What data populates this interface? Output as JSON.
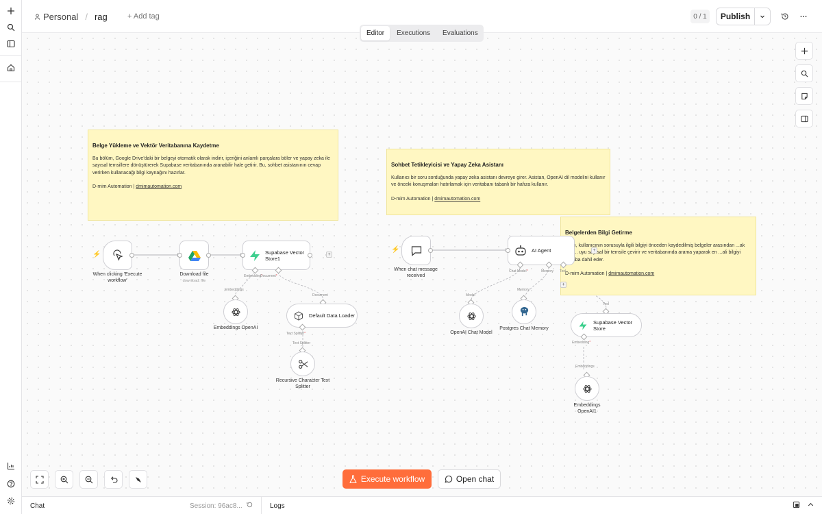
{
  "header": {
    "personal": "Personal",
    "separator": "/",
    "project": "rag",
    "add_tag": "+ Add tag",
    "counter": "0 / 1",
    "publish": "Publish"
  },
  "tabs": [
    {
      "label": "Editor",
      "active": true
    },
    {
      "label": "Executions",
      "active": false
    },
    {
      "label": "Evaluations",
      "active": false
    }
  ],
  "stickies": [
    {
      "title": "Belge Yükleme ve Vektör Veritabanına Kaydetme",
      "body": "Bu bölüm, Google Drive'daki bir belgeyi otomatik olarak indirir, içeriğini anlamlı parçalara böler ve yapay zeka ile sayısal temsillere dönüştürerek Supabase veritabanında aranabilir hale getirir. Bu, sohbet asistanının cevap verirken kullanacağı bilgi kaynağını hazırlar.",
      "credit_prefix": "D-mim Automation | ",
      "credit_link": "dmimautomation.com"
    },
    {
      "title": "Sohbet Tetikleyicisi ve Yapay Zeka Asistanı",
      "body": "Kullanıcı bir soru sorduğunda yapay zeka asistanı devreye girer. Asistan, OpenAI dil modelini kullanır ve önceki konuşmaları hatırlamak için veritabanı tabanlı bir hafıza kullanır.",
      "credit_prefix": "D-mim Automation | ",
      "credit_link": "dmimautomation.com"
    },
    {
      "title": "Belgelerden Bilgi Getirme",
      "body": "...tan, kullanıcının sorusuyla ilgili bilgiyi önceden kaydedilmiş belgeler arasından ...ak için ... uyu sayısal bir temsile çevirir ve veritabanında arama yaparak en ...ali bilgiyi cevaba dahil eder.",
      "credit_prefix": "D-mim Automation | ",
      "credit_link": "dmimautomation.com"
    }
  ],
  "nodes": {
    "manual_trigger": {
      "label": "When clicking 'Execute workflow'"
    },
    "download_file": {
      "label": "Download file",
      "sublabel": "download: file"
    },
    "supabase1": {
      "label": "Supabase Vector Store1"
    },
    "embeddings_openai": {
      "label": "Embeddings OpenAI"
    },
    "default_loader": {
      "label": "Default Data Loader"
    },
    "text_splitter": {
      "label": "Recursive Character Text Splitter"
    },
    "chat_trigger": {
      "label": "When chat message received"
    },
    "ai_agent": {
      "label": "AI Agent"
    },
    "openai_chat": {
      "label": "OpenAI Chat Model"
    },
    "postgres_memory": {
      "label": "Postgres Chat Memory"
    },
    "supabase2": {
      "label": "Supabase Vector Store"
    },
    "embeddings_openai1": {
      "label": "Embeddings OpenAI1"
    }
  },
  "ports": {
    "embedding": "Embedding",
    "embedding_star": "*",
    "document": "Document",
    "document_star": "*",
    "embeddings": "Embeddings",
    "document_in": "Document",
    "text_splitter": "Text Splitter",
    "text_splitter_star": "*",
    "text_splitter_in": "Text Splitter",
    "chat_model": "Chat Model",
    "chat_model_star": "*",
    "memory": "Memory",
    "tool": "Tool",
    "model": "Model",
    "memory_in": "Memory",
    "tool_in": "Tool",
    "embedding2": "Embedding",
    "embedding2_star": "*",
    "embeddings2": "Embeddings"
  },
  "toolbar": {
    "execute": "Execute workflow",
    "open_chat": "Open chat"
  },
  "footer": {
    "chat": "Chat",
    "session": "Session: 96ac8...",
    "logs": "Logs"
  },
  "colors": {
    "accent": "#ff6d3b",
    "sticky": "#fff7c2",
    "supabase": "#3ecf8e",
    "postgres": "#336791"
  }
}
